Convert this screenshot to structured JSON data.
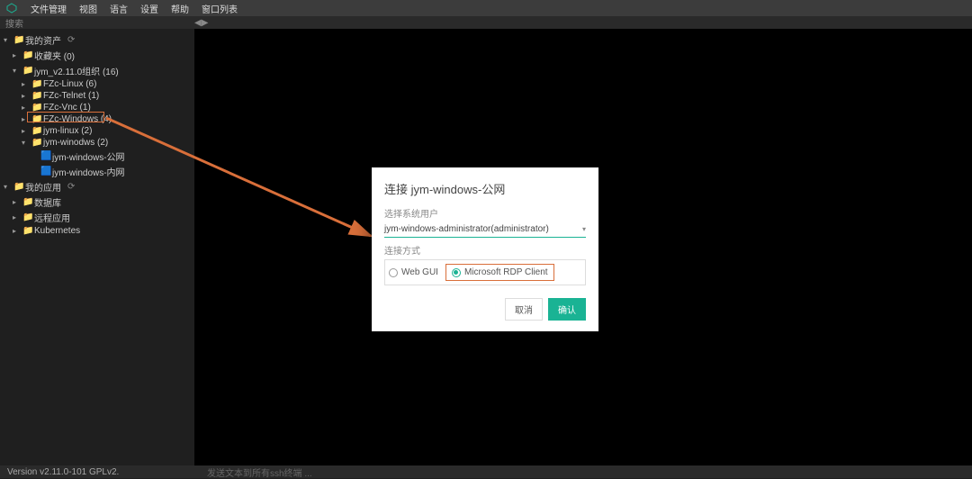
{
  "colors": {
    "accent": "#1ab394",
    "highlight": "#d96f3a"
  },
  "topbar": {
    "menus": [
      "文件管理",
      "视图",
      "语言",
      "设置",
      "帮助",
      "窗口列表"
    ]
  },
  "subbar": {
    "search_label": "搜索"
  },
  "sidebar": {
    "sections": [
      {
        "label": "我的资产",
        "refresh": true,
        "children": [
          {
            "label": "收藏夹 (0)"
          },
          {
            "label": "jym_v2.11.0组织 (16)",
            "expanded": true,
            "children": [
              {
                "label": "FZc-Linux (6)"
              },
              {
                "label": "FZc-Telnet (1)"
              },
              {
                "label": "FZc-Vnc (1)"
              },
              {
                "label": "FZc-Windows (4)"
              },
              {
                "label": "jym-linux (2)"
              },
              {
                "label": "jym-winodws (2)",
                "expanded": true,
                "children": [
                  {
                    "label": "jym-windows-公网",
                    "highlighted": true,
                    "leaf": true
                  },
                  {
                    "label": "jym-windows-内网",
                    "leaf": true
                  }
                ]
              }
            ]
          }
        ]
      },
      {
        "label": "我的应用",
        "refresh": true,
        "children": [
          {
            "label": "数据库"
          },
          {
            "label": "远程应用"
          },
          {
            "label": "Kubernetes"
          }
        ]
      }
    ]
  },
  "dialog": {
    "title": "连接 jym-windows-公网",
    "user_label": "选择系统用户",
    "user_value": "jym-windows-administrator(administrator)",
    "method_label": "连接方式",
    "options": [
      {
        "label": "Web GUI",
        "selected": false
      },
      {
        "label": "Microsoft RDP Client",
        "selected": true,
        "highlighted": true
      }
    ],
    "cancel": "取消",
    "confirm": "确认"
  },
  "bottombar": {
    "version": "Version v2.11.0-101 GPLv2.",
    "tip": "发送文本到所有ssh终端 ..."
  }
}
